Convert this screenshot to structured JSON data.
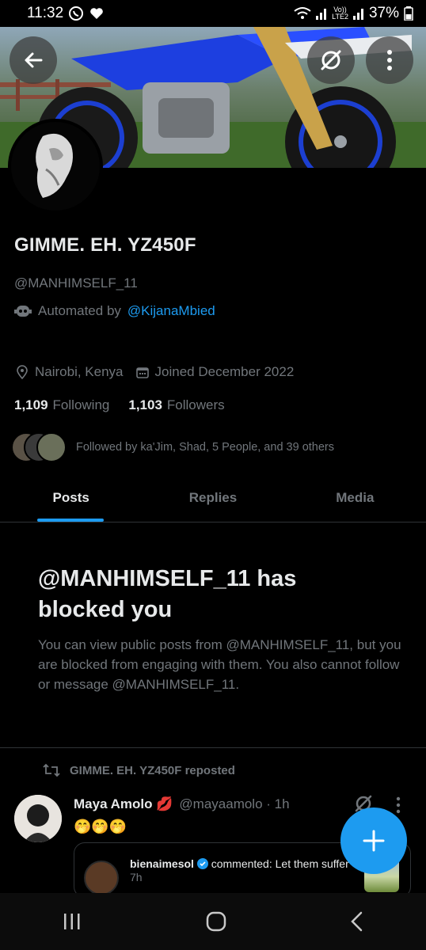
{
  "status_bar": {
    "time": "11:32",
    "network_top": "Vo))",
    "network_bottom": "LTE2",
    "battery": "37%"
  },
  "profile": {
    "display_name": "GIMME. EH. YZ450F",
    "handle": "@MANHIMSELF_11",
    "automated_prefix": "Automated by",
    "automated_by": "@KijanaMbied",
    "location": "Nairobi, Kenya",
    "joined": "Joined December 2022",
    "following_count": "1,109",
    "following_label": "Following",
    "followers_count": "1,103",
    "followers_label": "Followers",
    "followed_by": "Followed by ka'Jim, Shad, 5 People, and 39 others"
  },
  "tabs": [
    {
      "label": "Posts",
      "active": true
    },
    {
      "label": "Replies",
      "active": false
    },
    {
      "label": "Media",
      "active": false
    }
  ],
  "blocked": {
    "title": "@MANHIMSELF_11 has blocked you",
    "body": "You can view public posts from @MANHIMSELF_11, but you are blocked from engaging with them. You also cannot follow or message @MANHIMSELF_11."
  },
  "post": {
    "repost_label": "GIMME. EH. YZ450F reposted",
    "author_name": "Maya Amolo 💋",
    "author_handle": "@mayaamolo · 1h",
    "text": "🤭🤭🤭",
    "quote_author": "bienaimesol",
    "quote_text": " commented: Let them suffer",
    "quote_time": "7h"
  },
  "colors": {
    "accent": "#1d9bf0",
    "background": "#000000",
    "muted_text": "#71767b"
  }
}
